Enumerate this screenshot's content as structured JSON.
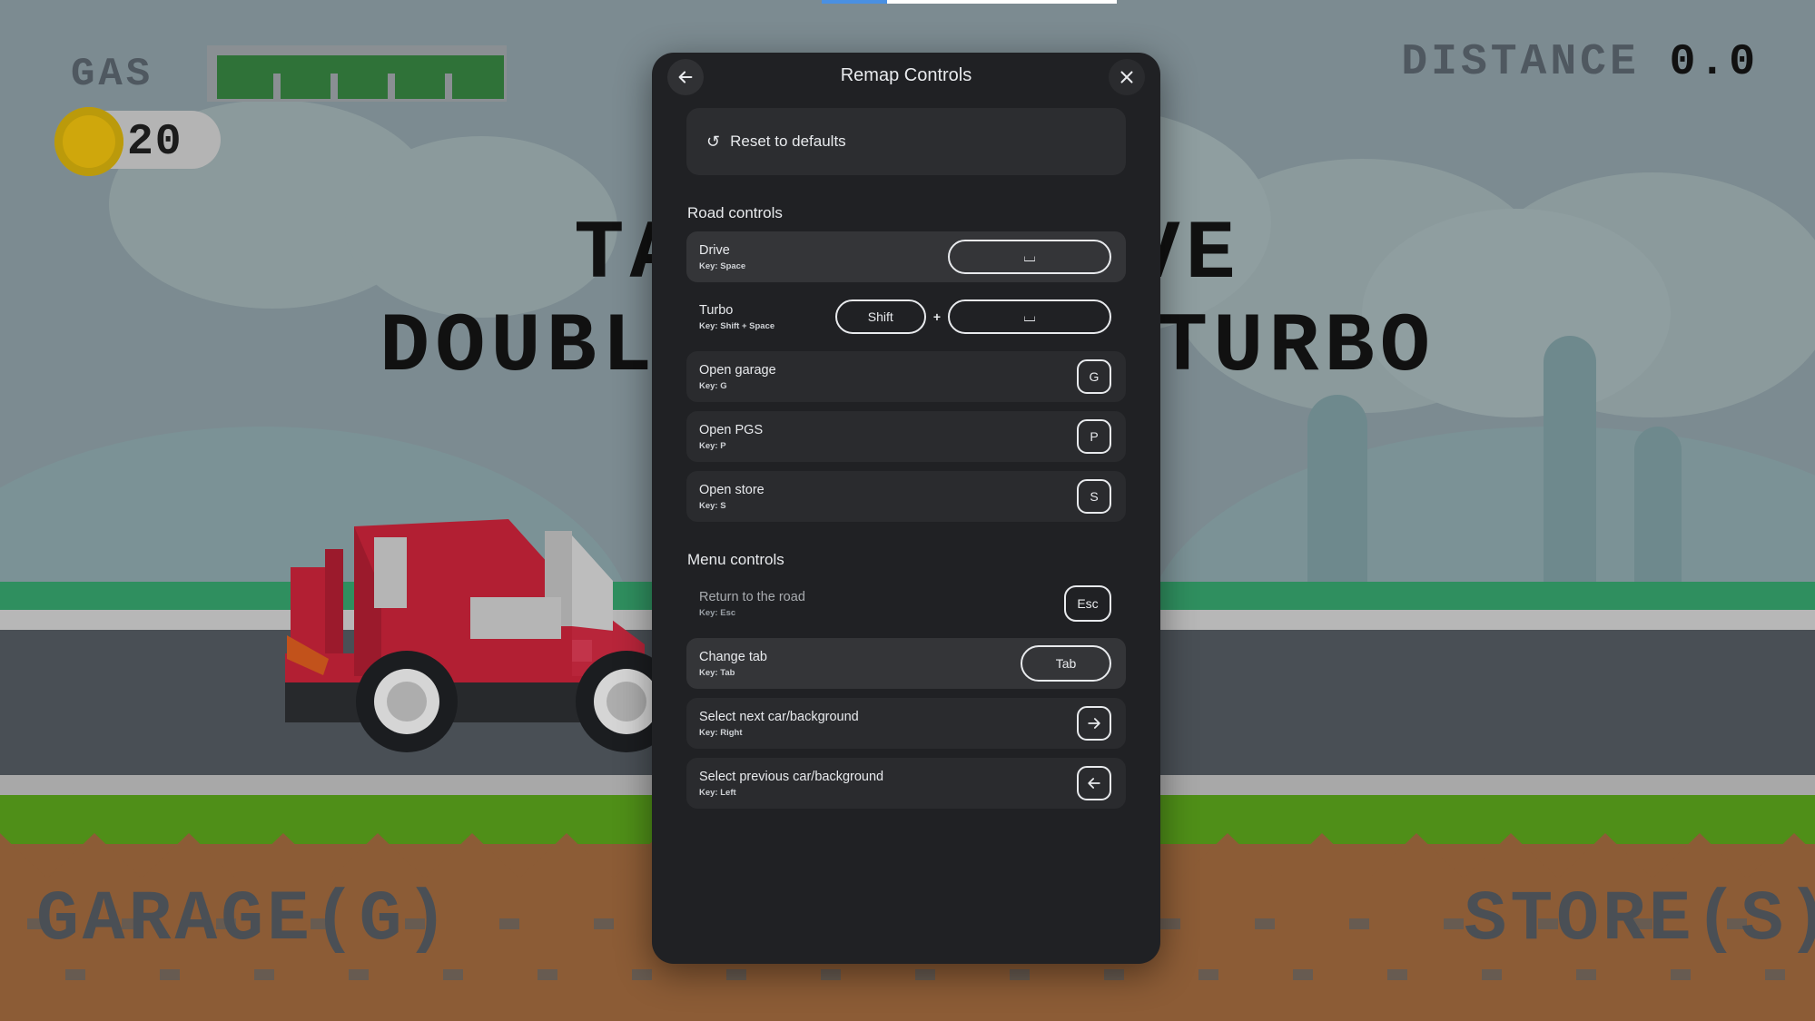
{
  "game": {
    "gas_label": "GAS",
    "gas_percent": 100,
    "coin_count": "20",
    "distance_label": "DISTANCE",
    "distance_value": "0.0",
    "hint_line1": "TAP TO DRIVE",
    "hint_line2": "DOUBLE TAP TO TURBO",
    "garage_label": "GARAGE(G)",
    "store_label": "STORE(S)",
    "colors": {
      "sky": "#7c8b91",
      "hill": "#7b9296",
      "road": "#494f55",
      "grass_near": "#4f8f18",
      "dirt": "#8c5c36",
      "car_body": "#b21f33",
      "gas_fill": "#2f7238",
      "coin": "#cfa70c"
    }
  },
  "browser": {
    "progress_percent": 22,
    "progress_color": "#4a90e2"
  },
  "modal": {
    "title": "Remap Controls",
    "back_icon": "arrow-left-icon",
    "close_icon": "close-icon",
    "reset": {
      "icon": "reset-icon",
      "glyph": "↺",
      "label": "Reset to defaults"
    },
    "sections": [
      {
        "title": "Road controls",
        "rows": [
          {
            "label": "Drive",
            "key_text": "Key: Space",
            "keys": [
              {
                "type": "wide",
                "glyph": "⌴",
                "name": "space"
              }
            ],
            "state": "hovered"
          },
          {
            "label": "Turbo",
            "key_text": "Key: Shift + Space",
            "keys": [
              {
                "type": "medium",
                "glyph": "Shift",
                "name": "shift"
              },
              {
                "type": "separator",
                "glyph": "+",
                "name": "plus"
              },
              {
                "type": "wide",
                "glyph": "⌴",
                "name": "space"
              }
            ],
            "state": "plain"
          },
          {
            "label": "Open garage",
            "key_text": "Key: G",
            "keys": [
              {
                "type": "square",
                "glyph": "G",
                "name": "g"
              }
            ],
            "state": "normal"
          },
          {
            "label": "Open PGS",
            "key_text": "Key: P",
            "keys": [
              {
                "type": "square",
                "glyph": "P",
                "name": "p"
              }
            ],
            "state": "normal"
          },
          {
            "label": "Open store",
            "key_text": "Key: S",
            "keys": [
              {
                "type": "square",
                "glyph": "S",
                "name": "s"
              }
            ],
            "state": "normal"
          }
        ]
      },
      {
        "title": "Menu controls",
        "rows": [
          {
            "label": "Return to the road",
            "key_text": "Key: Esc",
            "keys": [
              {
                "type": "esc",
                "glyph": "Esc",
                "name": "esc"
              }
            ],
            "state": "dim"
          },
          {
            "label": "Change tab",
            "key_text": "Key: Tab",
            "keys": [
              {
                "type": "tab",
                "glyph": "Tab",
                "name": "tab"
              }
            ],
            "state": "hovered"
          },
          {
            "label": "Select next car/background",
            "key_text": "Key: Right",
            "keys": [
              {
                "type": "square",
                "glyph": "",
                "icon": "arrow-right-icon",
                "name": "right"
              }
            ],
            "state": "normal"
          },
          {
            "label": "Select previous car/background",
            "key_text": "Key: Left",
            "keys": [
              {
                "type": "square",
                "glyph": "",
                "icon": "arrow-left-icon",
                "name": "left"
              }
            ],
            "state": "normal"
          }
        ]
      }
    ]
  }
}
